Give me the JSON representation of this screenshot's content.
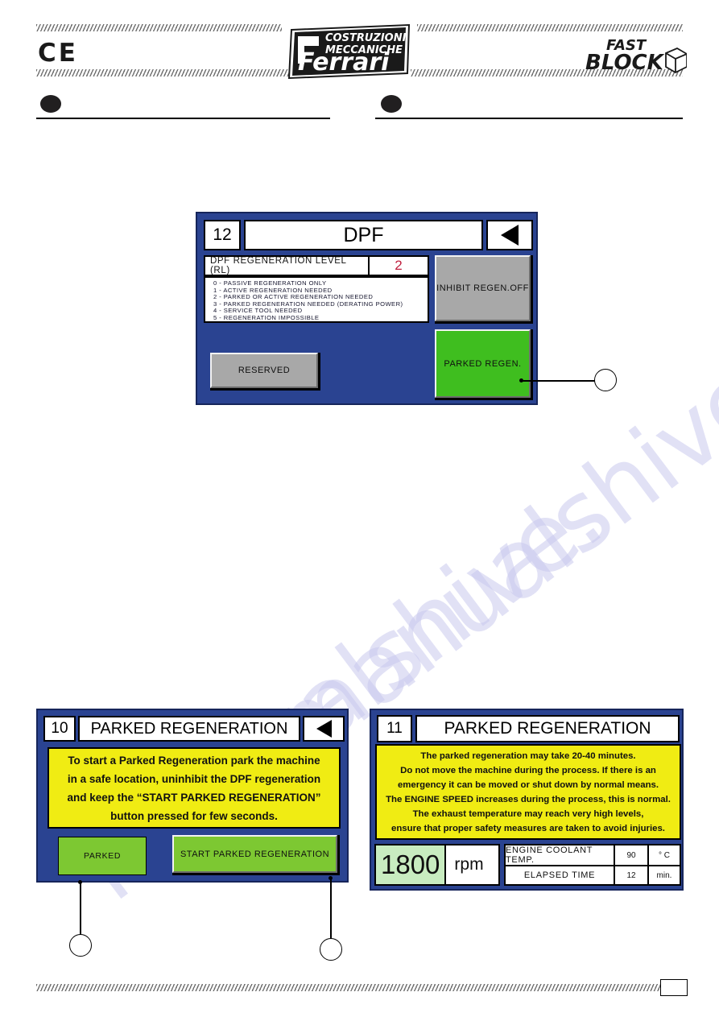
{
  "header": {
    "ce_mark": "CE",
    "brand_primary_line1": "COSTRUZIONI",
    "brand_primary_line2": "MECCANICHE",
    "brand_primary_name": "Ferrari",
    "brand_secondary_line1": "FAST",
    "brand_secondary_line2": "BLOCK"
  },
  "watermark": {
    "line1": "manualshive.",
    "line2": "manualshive.com"
  },
  "footer": {
    "page_number": ""
  },
  "colors": {
    "screen_background": "#2a4391",
    "screen_border": "#16255a",
    "notice_yellow": "#f0ec13",
    "button_green": "#3fbe1f",
    "flat_green": "#7dc832",
    "button_grey": "#a8a8a8",
    "rpm_green": "#c8ecc0",
    "alert_red": "#c0203f"
  },
  "screen_dpf": {
    "number": "12",
    "title": "DPF",
    "back_icon": "triangle-left-icon",
    "rl_label": "DPF  REGENERATION  LEVEL  (RL)",
    "rl_value": "2",
    "legend": [
      "0 -  PASSIVE  REGENERATION  ONLY",
      "1 -  ACTIVE  REGENERATION  NEEDED",
      "2 -  PARKED  OR  ACTIVE  REGENERATION  NEEDED",
      "3 -  PARKED  REGENERATION  NEEDED  (DERATING  POWER)",
      "4 -  SERVICE  TOOL  NEEDED",
      "5 -  REGENERATION  IMPOSSIBLE"
    ],
    "btn_inhibit": "INHIBIT REGEN.OFF",
    "btn_parked_regen": "PARKED  REGEN.",
    "btn_reserved": "RESERVED"
  },
  "screen_parked_10": {
    "number": "10",
    "title": "PARKED  REGENERATION",
    "back_icon": "triangle-left-icon",
    "notice": [
      "To start a Parked Regeneration park the machine",
      "in a safe location, uninhibit the DPF regeneration",
      "and keep the “START PARKED REGENERATION”",
      "button pressed for few seconds."
    ],
    "btn_parked": "PARKED",
    "btn_start": "START  PARKED  REGENERATION"
  },
  "screen_parked_11": {
    "number": "11",
    "title": "PARKED  REGENERATION",
    "notice": [
      "The parked regeneration may take 20-40 minutes.",
      "Do not move the machine during the process. If there is an",
      "emergency it can be moved or shut down by normal means.",
      "The ENGINE SPEED increases during the process, this is normal.",
      "The exhaust temperature may reach very high levels,",
      "ensure that proper safety measures are taken to avoid injuries."
    ],
    "rpm_value": "1800",
    "rpm_unit": "rpm",
    "metrics": [
      {
        "label": "ENGINE  COOLANT  TEMP.",
        "value": "90",
        "unit": "°  C"
      },
      {
        "label": "ELAPSED  TIME",
        "value": "12",
        "unit": "min."
      }
    ]
  },
  "callouts": {
    "dpf_parked_regen": "",
    "parked_button": "",
    "start_button": ""
  }
}
